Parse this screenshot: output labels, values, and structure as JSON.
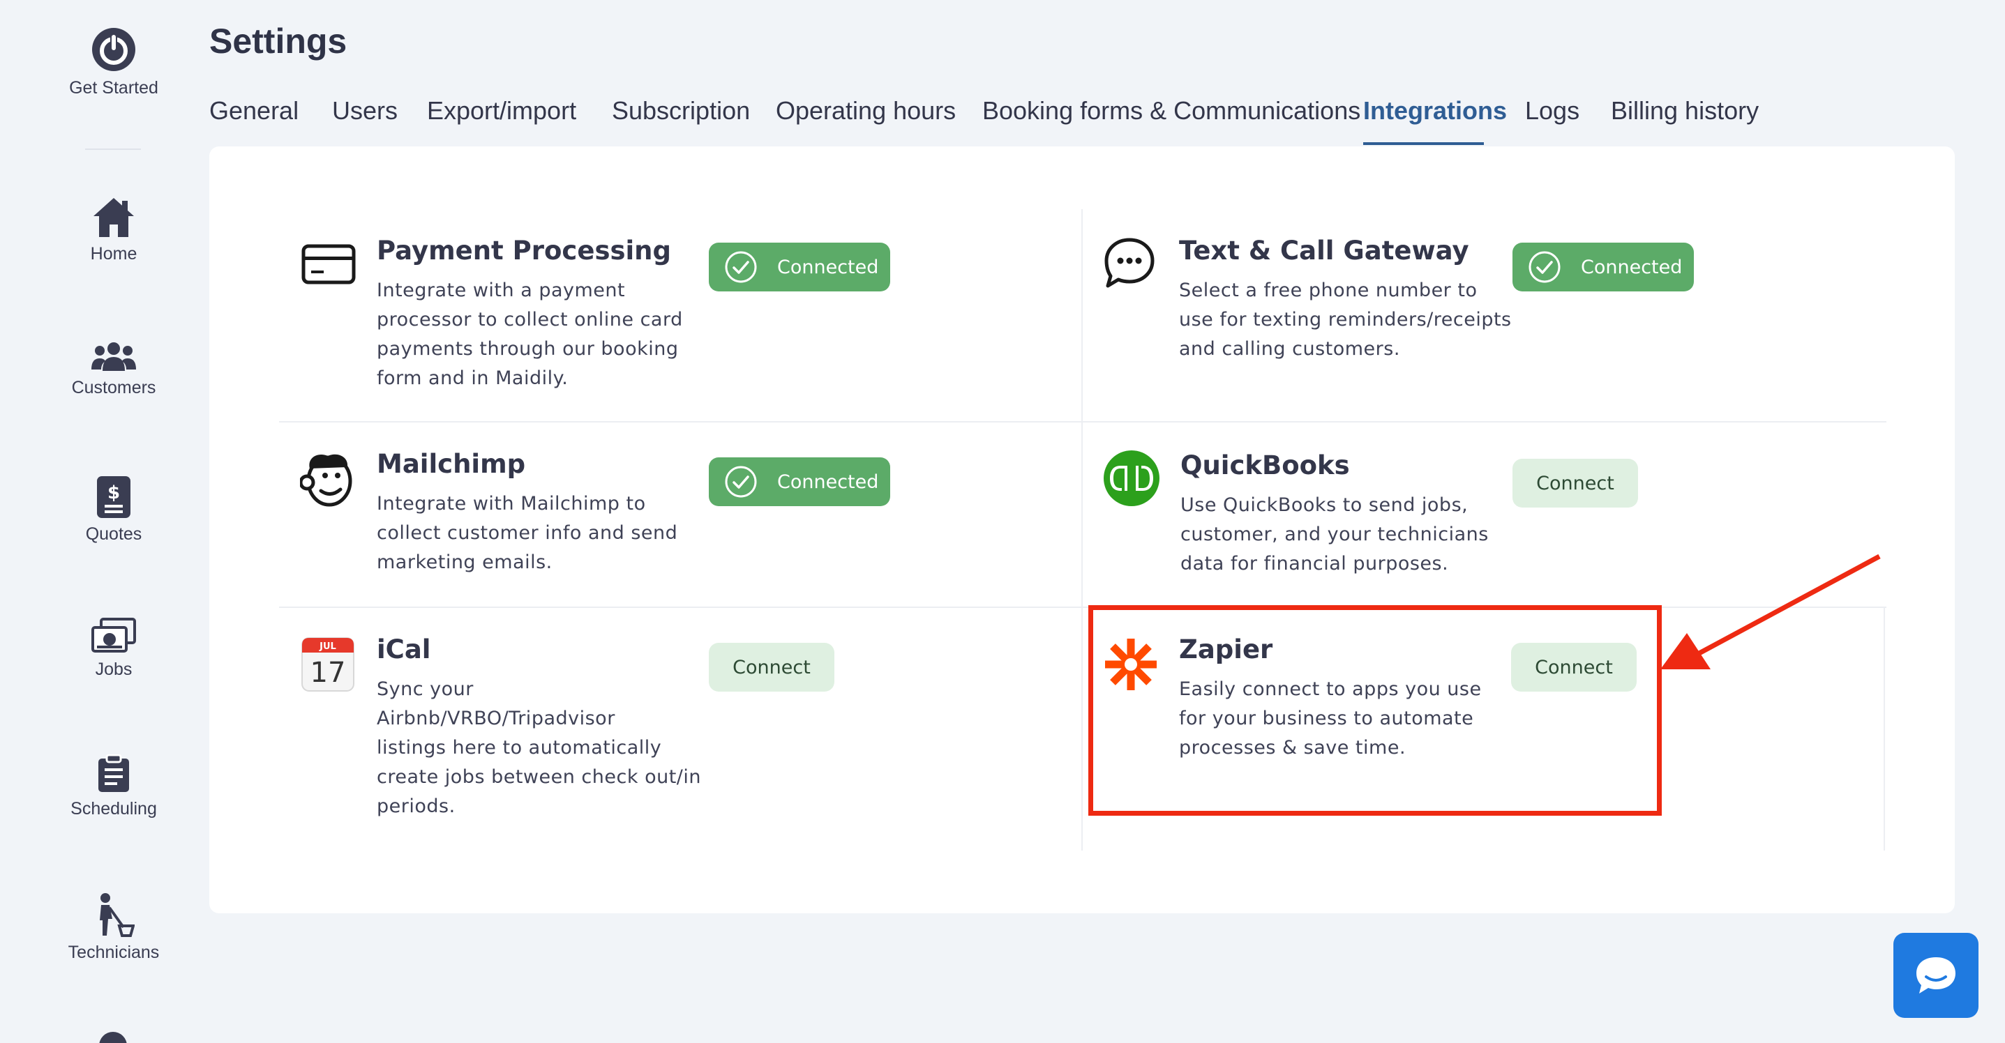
{
  "sidebar": {
    "items": [
      {
        "label": "Get Started",
        "icon": "power-icon"
      },
      {
        "label": "Home",
        "icon": "home-icon"
      },
      {
        "label": "Customers",
        "icon": "customers-icon"
      },
      {
        "label": "Quotes",
        "icon": "quotes-icon"
      },
      {
        "label": "Jobs",
        "icon": "jobs-icon"
      },
      {
        "label": "Scheduling",
        "icon": "scheduling-icon"
      },
      {
        "label": "Technicians",
        "icon": "technicians-icon"
      }
    ]
  },
  "header": {
    "title": "Settings",
    "tabs": [
      {
        "label": "General"
      },
      {
        "label": "Users"
      },
      {
        "label": "Export/import"
      },
      {
        "label": "Subscription"
      },
      {
        "label": "Operating hours"
      },
      {
        "label": "Booking forms & Communications"
      },
      {
        "label": "Integrations",
        "active": true
      },
      {
        "label": "Logs"
      },
      {
        "label": "Billing history"
      }
    ]
  },
  "integrations": {
    "payment": {
      "title": "Payment Processing",
      "desc": [
        "Integrate with a payment",
        "processor to collect online card",
        "payments through our booking",
        "form and in Maidily."
      ],
      "button": "Connected"
    },
    "text_call": {
      "title": "Text & Call Gateway",
      "desc": [
        "Select a free phone number to",
        "use for texting reminders/receipts",
        "and calling customers."
      ],
      "button": "Connected"
    },
    "mailchimp": {
      "title": "Mailchimp",
      "desc": [
        "Integrate with Mailchimp to",
        "collect customer info and send",
        "marketing emails."
      ],
      "button": "Connected"
    },
    "quickbooks": {
      "title": "QuickBooks",
      "desc": [
        "Use QuickBooks to send jobs,",
        "customer, and your technicians",
        "data for financial purposes."
      ],
      "button": "Connect"
    },
    "ical": {
      "title": "iCal",
      "desc": [
        "Sync your",
        "Airbnb/VRBO/Tripadvisor",
        "listings here to automatically",
        "create jobs between check out/in",
        "periods."
      ],
      "button": "Connect",
      "icon_month": "JUL",
      "icon_day": "17"
    },
    "zapier": {
      "title": "Zapier",
      "desc": [
        "Easily connect to apps you use",
        "for your business to automate",
        "processes & save time."
      ],
      "button": "Connect"
    }
  },
  "colors": {
    "connected_green": "#5cab68",
    "connect_bg": "#dff0e1",
    "active_tab": "#2f5d94",
    "highlight_red": "#ee2a12",
    "chat_blue": "#1f7ae0"
  }
}
